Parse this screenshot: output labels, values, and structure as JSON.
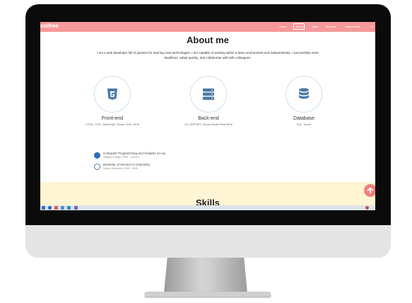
{
  "navbar": {
    "brand": "oolhee",
    "items": [
      "Home",
      "About",
      "Skills",
      "My work",
      "Testimonials",
      "Co"
    ],
    "active": "About",
    "bg_color": "#f6999a"
  },
  "about": {
    "title": "About me",
    "description": "I am a web developer full of passion for learning new technologies. I am capable of working within a team environment and independently. I successfully meet deadlines, adapt quickly, and collaborate well with colleagues."
  },
  "skills": [
    {
      "icon": "html5-icon",
      "title": "Front-end",
      "details": "HTML, CSS, JavaScript, React, Web, APIs"
    },
    {
      "icon": "server-icon",
      "title": "Back-end",
      "details": "C#, ASP.NET, Visual Studio Rest APIs"
    },
    {
      "icon": "database-icon",
      "title": "Database",
      "details": "SQL, Azure"
    }
  ],
  "education": [
    {
      "title": "Computer Programming and Analysis Co-op",
      "meta": "Niagara College | 2021 - Current",
      "icon": "college-logo-icon"
    },
    {
      "title": "Bachelor of Science in Chemistry",
      "meta": "Hallym University | 2002 - 2006",
      "icon": "university-logo-icon"
    }
  ],
  "skills_section": {
    "title": "Skills",
    "bg_color": "#fdf5d3"
  },
  "scroll_top": {
    "icon": "arrow-up-icon",
    "color": "#f08080"
  }
}
